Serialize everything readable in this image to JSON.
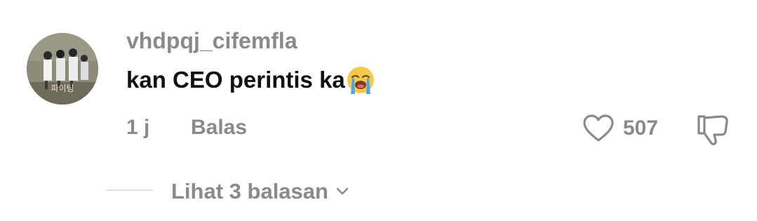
{
  "comment": {
    "username": "vhdpqj_cifemfla",
    "text": "kan CEO perintis ka",
    "emoji": "loudly-crying-face",
    "time": "1 j",
    "reply_label": "Balas",
    "like_count": "507",
    "view_replies_label": "Lihat 3 balasan"
  },
  "avatar": {
    "caption": "파이팅"
  },
  "icons": {
    "like": "heart-icon",
    "dislike": "thumbs-down-icon",
    "expand": "chevron-down-icon"
  },
  "colors": {
    "muted_text": "#8a8a8a",
    "body_text": "#111111",
    "divider": "#e3e3e3",
    "background": "#ffffff"
  }
}
